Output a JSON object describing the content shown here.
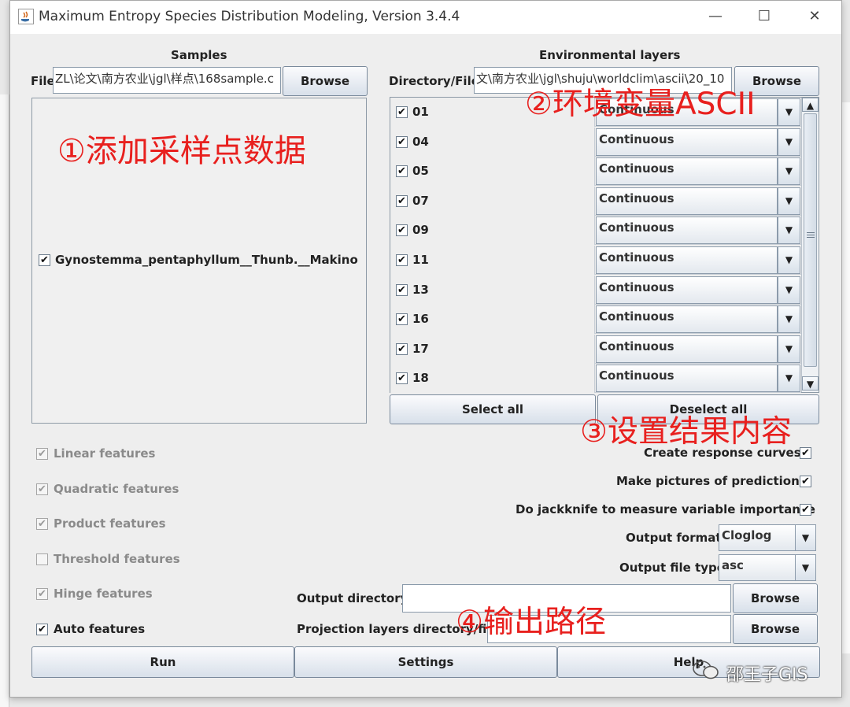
{
  "window": {
    "title": "Maximum Entropy Species Distribution Modeling, Version 3.4.4",
    "minimize_glyph": "—",
    "maximize_glyph": "☐",
    "close_glyph": "✕"
  },
  "samples": {
    "header": "Samples",
    "file_label": "File",
    "file_value": "ZL\\论文\\南方农业\\jgl\\样点\\168sample.c",
    "browse_label": "Browse",
    "species": [
      {
        "name": "Gynostemma_pentaphyllum__Thunb.__Makino",
        "checked": true
      }
    ]
  },
  "env": {
    "header": "Environmental layers",
    "dir_label": "Directory/File",
    "dir_value": "文\\南方农业\\jgl\\shuju\\worldclim\\ascii\\20_10",
    "browse_label": "Browse",
    "layers": [
      {
        "name": "01",
        "type": "Continuous"
      },
      {
        "name": "04",
        "type": "Continuous"
      },
      {
        "name": "05",
        "type": "Continuous"
      },
      {
        "name": "07",
        "type": "Continuous"
      },
      {
        "name": "09",
        "type": "Continuous"
      },
      {
        "name": "11",
        "type": "Continuous"
      },
      {
        "name": "13",
        "type": "Continuous"
      },
      {
        "name": "16",
        "type": "Continuous"
      },
      {
        "name": "17",
        "type": "Continuous"
      },
      {
        "name": "18",
        "type": "Continuous"
      }
    ],
    "select_all": "Select all",
    "deselect_all": "Deselect all"
  },
  "features": [
    {
      "label": "Linear features",
      "checked": true,
      "enabled": false
    },
    {
      "label": "Quadratic features",
      "checked": true,
      "enabled": false
    },
    {
      "label": "Product features",
      "checked": true,
      "enabled": false
    },
    {
      "label": "Threshold features",
      "checked": false,
      "enabled": false
    },
    {
      "label": "Hinge features",
      "checked": true,
      "enabled": false
    },
    {
      "label": "Auto features",
      "checked": true,
      "enabled": true
    }
  ],
  "options": {
    "response_curves": "Create response curves",
    "pictures": "Make pictures of predictions",
    "jackknife": "Do jackknife to measure variable importance",
    "output_format_label": "Output format",
    "output_format_value": "Cloglog",
    "output_type_label": "Output file type",
    "output_type_value": "asc",
    "output_dir_label": "Output directory",
    "output_dir_value": "",
    "projection_label": "Projection layers directory/file",
    "projection_value": "",
    "browse_label": "Browse"
  },
  "bottom": {
    "run": "Run",
    "settings": "Settings",
    "help": "Help"
  },
  "annotations": {
    "a1": "①添加采样点数据",
    "a2": "②环境变量ASCII",
    "a3": "③设置结果内容",
    "a4": "④输出路径"
  },
  "watermark": "邵王子GIS",
  "colors": {
    "annotation": "#e8201e",
    "button_top": "#fbfbfd",
    "button_bottom": "#d8e0ea"
  }
}
